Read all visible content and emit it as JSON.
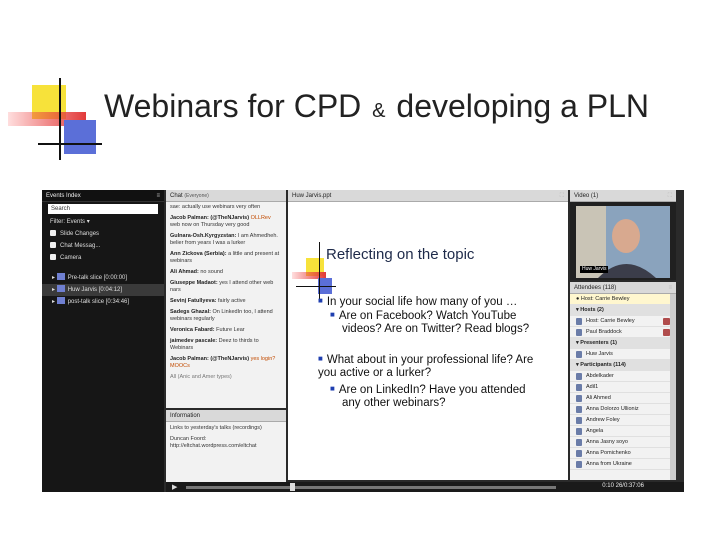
{
  "slide": {
    "title_part1": "Webinars for CPD",
    "title_amp": "&",
    "title_part2": "developing a PLN"
  },
  "events": {
    "header": "Events Index",
    "search_value": "Search",
    "filter_label": "Filter: Events",
    "checkboxes": [
      "Slide Changes",
      "Chat Messag...",
      "Camera"
    ],
    "segments": [
      {
        "label": "Pre-talk slice [0:00:00]"
      },
      {
        "label": "Huw Jarvis [0:04:12]"
      },
      {
        "label": "post-talk slice [0:34:46]"
      }
    ]
  },
  "chat": {
    "header": "Chat",
    "header_sub": "(Everyone)",
    "messages": [
      {
        "name": "",
        "text": "sae: actually use webinars very often"
      },
      {
        "name": "Jacob Palman: (@TheNJarvis)",
        "text": "OLLRev",
        "hl": "web now on Thursday very good"
      },
      {
        "name": "Gulnara-Osh.Kyrgyzstan:",
        "text": "I am Ahmedheh. belier from years I was a lurker"
      },
      {
        "name": "Ann Zickova (Serbia):",
        "text": "a little and present at webinars"
      },
      {
        "name": "Ali Ahmad:",
        "text": "no sound"
      },
      {
        "name": "Giuseppe Madaot:",
        "text": "yes I attend other web nars"
      },
      {
        "name": "Sevinj Fatullyeva:",
        "text": "fairly active"
      },
      {
        "name": "Sadegs Ghazal:",
        "text": "On LinkedIn too, I attend webinars regularly"
      },
      {
        "name": "Veronica Fabard:",
        "text": "Future Lear"
      },
      {
        "name": "jaimedev pascale:",
        "text": "Deez to thirds to Webinars"
      },
      {
        "name": "Jacob Palman: (@TheNJarvis)",
        "text": "yes",
        "hl": "login? MOOCs"
      },
      {
        "name": "",
        "text": "All (Anic and Amer types)"
      }
    ]
  },
  "information": {
    "header": "Information",
    "text1": "Links to yesterday's talks (recordings)",
    "text2": "Duncan Foord:",
    "text3": "http://eltchat.wordpress.com/eltchat"
  },
  "share": {
    "header": "Huw Jarvis.ppt",
    "slide_heading": "Reflecting on the topic",
    "lines": [
      {
        "text": "In your social life how many of you …",
        "level": 1
      },
      {
        "text": "Are on Facebook? Watch YouTube",
        "level": 2
      },
      {
        "text": "videos? Are on Twitter? Read blogs?",
        "level": 2,
        "cont": true
      },
      {
        "text": "What about in your professional life? Are",
        "level": 1
      },
      {
        "text": "you active or a lurker?",
        "level": 1,
        "cont": true
      },
      {
        "text": "Are on LinkedIn? Have you attended",
        "level": 2
      },
      {
        "text": "any other webinars?",
        "level": 2,
        "cont": true
      }
    ]
  },
  "video": {
    "header": "Video",
    "count": "(1)",
    "name_label": "Huw Jarvis"
  },
  "attendees": {
    "header": "Attendees",
    "count": "(118)",
    "host_label": "Host: Carrie Bewley",
    "hosts_group": "Hosts (2)",
    "hosts": [
      "Host: Carrie Bewley",
      "Paul Braddock"
    ],
    "presenters_group": "Presenters (1)",
    "presenters": [
      "Huw Jarvis"
    ],
    "participants_group": "Participants (114)",
    "participants": [
      "Abdelkader",
      "Adil1",
      "Ali Ahmed",
      "Anna Dolorzo Ullioniz",
      "Andrew Foley",
      "Angela",
      "Anna Jasny soyo",
      "Anna Pomichenko",
      "Anna from Ukraine"
    ]
  },
  "player": {
    "timer": "0:10 26/0:37:06",
    "play_icon": "play-icon"
  }
}
